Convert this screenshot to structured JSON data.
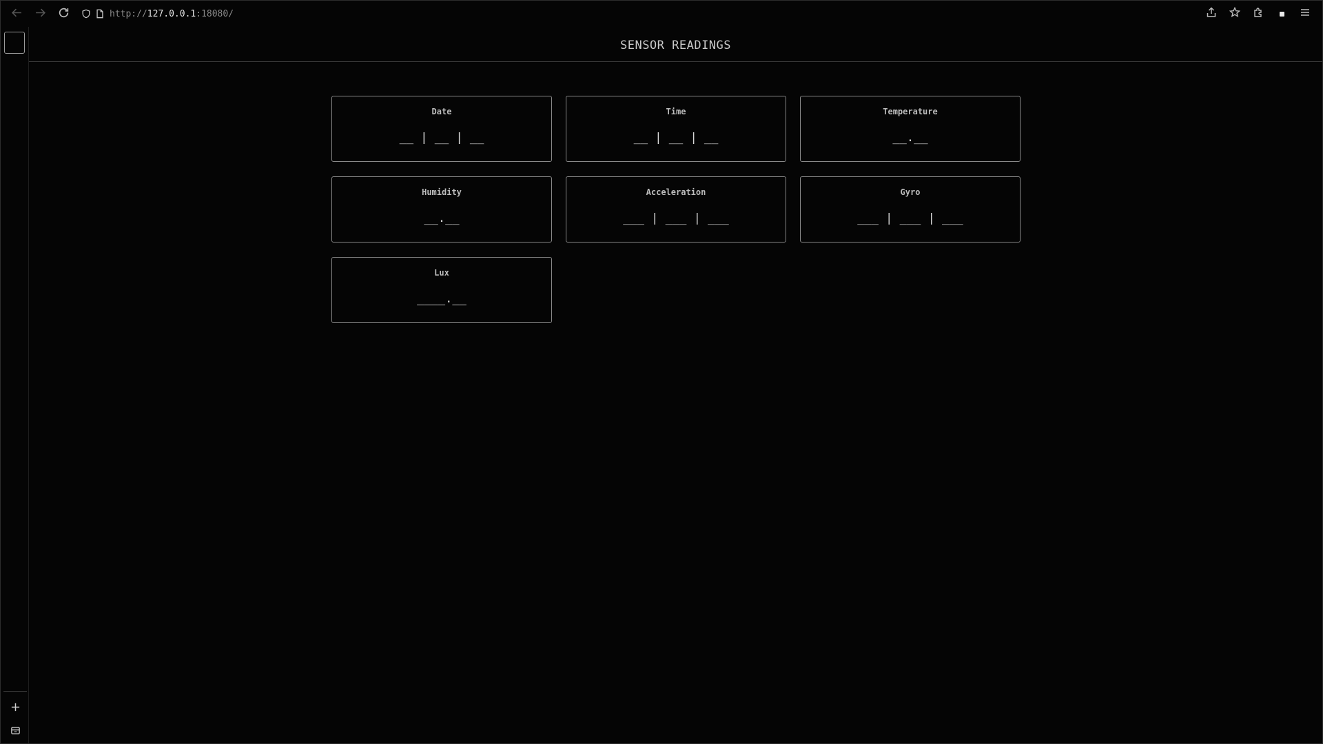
{
  "browser": {
    "url_scheme": "http://",
    "url_host": "127.0.0.1",
    "url_port_path": ":18080/",
    "icons": {
      "back": "arrow-left-icon",
      "forward": "arrow-right-icon",
      "reload": "reload-icon",
      "shield": "shield-icon",
      "page": "page-icon",
      "share": "share-icon",
      "bookmark": "star-icon",
      "extensions": "puzzle-icon",
      "menu": "hamburger-menu-icon"
    }
  },
  "sidebar": {
    "icons": {
      "new_tab": "plus-icon",
      "bottom": "tray-icon"
    }
  },
  "page": {
    "title": "SENSOR READINGS"
  },
  "cards": [
    {
      "label": "Date",
      "value": "__ | __ | __"
    },
    {
      "label": "Time",
      "value": "__ | __ | __"
    },
    {
      "label": "Temperature",
      "value": "__.__"
    },
    {
      "label": "Humidity",
      "value": "__.__"
    },
    {
      "label": "Acceleration",
      "value": "___ | ___ | ___"
    },
    {
      "label": "Gyro",
      "value": "___ | ___ | ___"
    },
    {
      "label": "Lux",
      "value": "____.__"
    }
  ],
  "colors": {
    "background": "#050505",
    "card_border": "#8a8a8a",
    "text": "#d0d0d0"
  }
}
